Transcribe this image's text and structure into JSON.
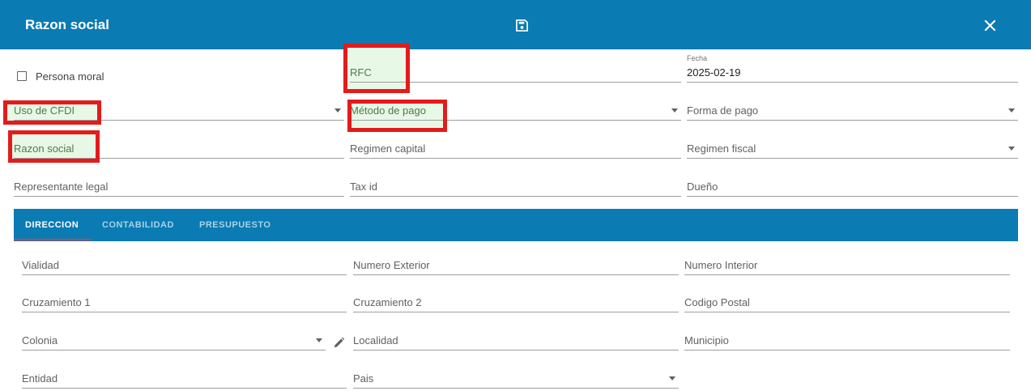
{
  "header": {
    "title": "Razon social",
    "save_icon": "save-icon",
    "close_icon": "close-icon",
    "bg_color": "#0a7bb3"
  },
  "form": {
    "persona_moral": {
      "label": "Persona moral",
      "checked": false
    },
    "rfc": {
      "label": "RFC"
    },
    "fecha": {
      "label": "Fecha",
      "value": "2025-02-19"
    },
    "uso_cfdi": {
      "label": "Uso de CFDI"
    },
    "metodo_pago": {
      "label": "Método de pago"
    },
    "forma_pago": {
      "label": "Forma de pago"
    },
    "razon_social": {
      "label": "Razon social"
    },
    "regimen_capital": {
      "label": "Regimen capital"
    },
    "regimen_fiscal": {
      "label": "Regimen fiscal"
    },
    "representante_legal": {
      "label": "Representante legal"
    },
    "tax_id": {
      "label": "Tax id"
    },
    "dueno": {
      "label": "Dueño"
    }
  },
  "tabs": [
    {
      "label": "DIRECCION",
      "active": true
    },
    {
      "label": "CONTABILIDAD",
      "active": false
    },
    {
      "label": "PRESUPUESTO",
      "active": false
    }
  ],
  "address": {
    "vialidad": {
      "label": "Vialidad"
    },
    "numero_exterior": {
      "label": "Numero Exterior"
    },
    "numero_interior": {
      "label": "Numero Interior"
    },
    "cruzamiento1": {
      "label": "Cruzamiento 1"
    },
    "cruzamiento2": {
      "label": "Cruzamiento 2"
    },
    "codigo_postal": {
      "label": "Codigo Postal"
    },
    "colonia": {
      "label": "Colonia"
    },
    "localidad": {
      "label": "Localidad"
    },
    "municipio": {
      "label": "Municipio"
    },
    "entidad": {
      "label": "Entidad"
    },
    "pais": {
      "label": "Pais"
    }
  },
  "colors": {
    "highlight_border": "#e31b1b",
    "highlight_fill": "#e8f8e6",
    "tab_underline": "#e23a3a"
  }
}
